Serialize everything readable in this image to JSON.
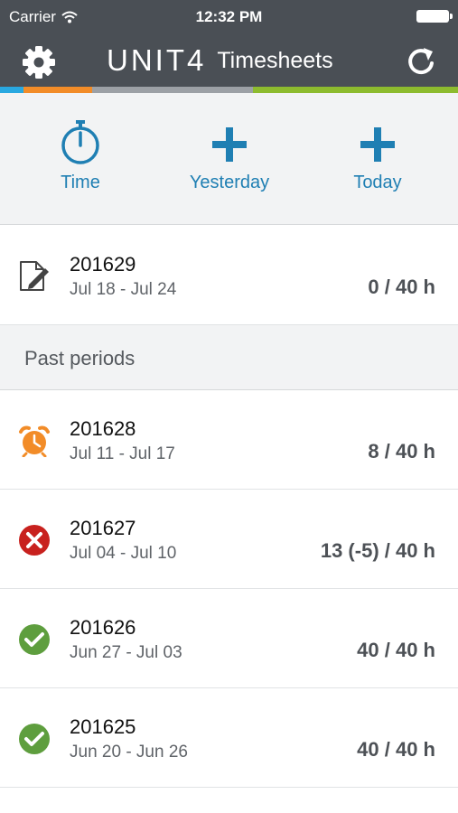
{
  "status_bar": {
    "carrier": "Carrier",
    "time": "12:32 PM"
  },
  "nav": {
    "logo": "UNIT4",
    "title": "Timesheets",
    "settings_icon": "gear-icon",
    "refresh_icon": "refresh-icon"
  },
  "brand_colors": {
    "header_bg": "#4a4f55",
    "strip": [
      "#29a8e0",
      "#f28c28",
      "#9ca0a5",
      "#8dbb2e"
    ],
    "accent": "#1f7fb3"
  },
  "actions": [
    {
      "label": "Time",
      "icon": "stopwatch-icon"
    },
    {
      "label": "Yesterday",
      "icon": "plus-icon"
    },
    {
      "label": "Today",
      "icon": "plus-icon"
    }
  ],
  "current_period": {
    "code": "201629",
    "dates": "Jul 18 - Jul 24",
    "hours": "0 / 40 h",
    "icon": "edit-document-icon"
  },
  "past_section": {
    "title": "Past periods"
  },
  "past_periods": [
    {
      "code": "201628",
      "dates": "Jul 11 - Jul 17",
      "hours": "8 / 40 h",
      "status": "alarm-clock-icon"
    },
    {
      "code": "201627",
      "dates": "Jul 04 - Jul 10",
      "hours": "13 (-5) / 40 h",
      "status": "rejected-icon"
    },
    {
      "code": "201626",
      "dates": "Jun 27 - Jul 03",
      "hours": "40 / 40 h",
      "status": "approved-icon"
    },
    {
      "code": "201625",
      "dates": "Jun 20 - Jun 26",
      "hours": "40 / 40 h",
      "status": "approved-icon"
    }
  ]
}
